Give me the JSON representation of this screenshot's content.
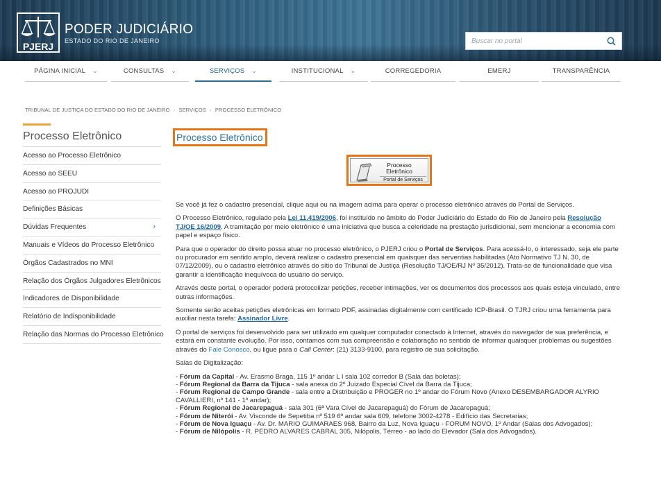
{
  "header": {
    "logo_abbr": "PJERJ",
    "logo_title": "PODER JUDICIÁRIO",
    "logo_subtitle": "ESTADO DO RIO DE JANEIRO",
    "search_placeholder": "Buscar no portal",
    "search_icon": "search-icon"
  },
  "nav": {
    "items": [
      {
        "label": "PÁGINA INICIAL",
        "has_dropdown": true
      },
      {
        "label": "CONSULTAS",
        "has_dropdown": true
      },
      {
        "label": "SERVIÇOS",
        "has_dropdown": true,
        "active": true
      },
      {
        "label": "INSTITUCIONAL",
        "has_dropdown": true
      },
      {
        "label": "CORREGEDORIA",
        "has_dropdown": false
      },
      {
        "label": "EMERJ",
        "has_dropdown": false
      },
      {
        "label": "TRANSPARÊNCIA",
        "has_dropdown": false
      }
    ],
    "chevron": "⌄"
  },
  "breadcrumb": {
    "items": [
      "TRIBUNAL DE JUSTIÇA DO ESTADO DO RIO DE JANEIRO",
      "SERVIÇOS",
      "PROCESSO ELETRÔNICO"
    ],
    "separator": "›"
  },
  "sidebar": {
    "title": "Processo Eletrônico",
    "accent_color": "#e8a33c",
    "items": [
      {
        "label": "Acesso ao Processo Eletrônico"
      },
      {
        "label": "Acesso ao SEEU"
      },
      {
        "label": "Acesso ao PROJUDI"
      },
      {
        "label": "Definições Básicas"
      },
      {
        "label": "Dúvidas Frequentes",
        "arrow": "›"
      },
      {
        "label": "Manuais e Vídeos do Processo Eletrônico"
      },
      {
        "label": "Órgãos Cadastrados no MNI"
      },
      {
        "label": "Relação dos Órgãos Julgadores Eletrônicos"
      },
      {
        "label": "Indicadores de Disponibilidade"
      },
      {
        "label": "Relatório de Indisponibilidade"
      },
      {
        "label": "Relação das Normas do Processo Eletrônico"
      }
    ]
  },
  "main": {
    "title": "Processo Eletrônico",
    "highlight_color": "#e57518",
    "portal_banner": {
      "line1": "Processo",
      "line2": "Eletrônico",
      "line3": "Portal de Serviços"
    },
    "p1": "Se você já fez o cadastro presencial, clique aqui ou na imagem acima para operar o processo eletrônico através do Portal de Serviços.",
    "p2": {
      "a": "O Processo Eletrônico, regulado pela ",
      "link1": "Lei 11.419/2006",
      "b": ", foi instituído no âmbito do Poder Judiciário do Estado do Rio de Janeiro pela ",
      "link2": "Resolução TJ/OE 16/2009",
      "c": ". A tramitação por meio eletrônico é uma iniciativa que busca a celeridade na prestação jurisdicional, sem mencionar a economia com papel e espaço físico."
    },
    "p3": {
      "a": "Para que o operador do direito possa atuar no processo eletrônico, o PJERJ criou o ",
      "bold": "Portal de Serviços",
      "b": ". Para acessá-lo, o interessado, seja ele parte ou procurador em sentido amplo, deverá realizar o cadastro presencial em quaisquer das serventias habilitadas (Ato Normativo TJ N. 30, de 07/12/2009), ou o cadastro eletrônico através do sítio do Tribunal de Justiça (Resolução TJ/OE/RJ Nº 35/2012). Trata-se de funcionalidade que visa garantir a identificação inequívoca do usuário do serviço."
    },
    "p4": "Através deste portal, o operador poderá protocolizar petições, receber intimações, ver os documentos dos processos aos quais esteja vinculado, entre outras informações.",
    "p5": {
      "a": "Somente serão aceitas petições eletrônicas em formato PDF, assinadas digitalmente com certificado ICP-Brasil. O TJRJ criou uma ferramenta para auxiliar nesta tarefa: ",
      "link": "Assinador Livre",
      "b": "."
    },
    "p6": {
      "a": "O portal de serviços foi desenvolvido para ser utilizado em qualquer computador conectado à Internet, através do navegador de sua preferência, e estará em constante evolução. Por isso, contamos com sua compreensão e colaboração no sentido de informar quaisquer problemas ou sugestões através do ",
      "link": "Fale Conosco",
      "b": ", ou ligue para o ",
      "italic": "Call Center",
      "c": ": (21) 3133-9100, para registro de sua solicitação."
    },
    "salas_title": "Salas de Digitalização:",
    "locations": [
      {
        "name": "Fórum da Capital",
        "text": " - Av. Erasmo Braga, 115 1º andar L I sala 102 corredor B (Sala das boletas);"
      },
      {
        "name": "Fórum Regional da Barra da Tijuca",
        "text": " - sala anexa do 2º Juizado Especial Cível da Barra da Tijuca;"
      },
      {
        "name": "Fórum Regional de Campo Grande",
        "text": " - sala entre a Distribuição e PROGER no 1º andar do Fórum Novo (Anexo DESEMBARGADOR ALYRIO CAVALLIERI, nº 141 - 1º andar);"
      },
      {
        "name": "Fórum Regional de Jacarepaguá",
        "text": " - sala 301 (6ª Vara Cível de Jacarepaguá) do Fórum de Jacarepaguá;"
      },
      {
        "name": "Fórum de Niterói",
        "text": " - Av. Visconde de Sepetiba nº 519 6º andar sala 609, telefone 3002-4278 - Edifício das Secretarias;"
      },
      {
        "name": "Fórum de Nova Iguaçu",
        "text": " - Av. Dr. MARIO GUIMARAES 968, Bairro da Luz, Nova Iguaçu - FORUM NOVO, 1º Andar (Salas dos Advogados);"
      },
      {
        "name": "Fórum de Nilópolis",
        "text": " - R. PEDRO ALVARES CABRAL 305, Nilópolis, Térreo - ao lado do Elevador (Sala dos Advogados)."
      }
    ]
  }
}
